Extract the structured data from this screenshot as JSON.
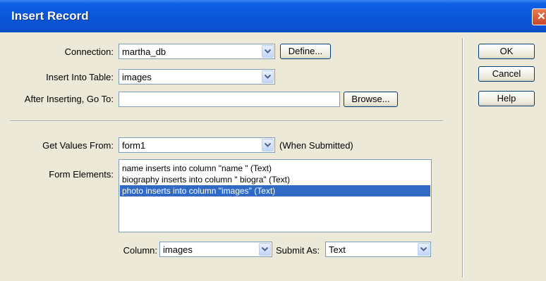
{
  "window": {
    "title": "Insert Record",
    "close_glyph": "✕"
  },
  "fields": {
    "connection": {
      "label": "Connection:",
      "value": "martha_db",
      "define_label": "Define..."
    },
    "insert_table": {
      "label": "Insert Into Table:",
      "value": "images"
    },
    "after_inserting": {
      "label": "After Inserting, Go To:",
      "value": "",
      "browse_label": "Browse..."
    },
    "get_values": {
      "label": "Get Values From:",
      "value": "form1",
      "note": "(When Submitted)"
    },
    "form_elements": {
      "label": "Form Elements:",
      "items": [
        "name inserts into column \"name  \" (Text)",
        "biography inserts into column \" biogra\" (Text)",
        "photo inserts into column \"images\" (Text)"
      ],
      "selected_index": 2
    },
    "column": {
      "label": "Column:",
      "value": "images"
    },
    "submit_as": {
      "label": "Submit As:",
      "value": "Text"
    }
  },
  "buttons": {
    "ok": "OK",
    "cancel": "Cancel",
    "help": "Help"
  },
  "colors": {
    "title_bar": "#0a55d8",
    "selection": "#316ac5",
    "dialog_bg": "#ece9d8"
  }
}
